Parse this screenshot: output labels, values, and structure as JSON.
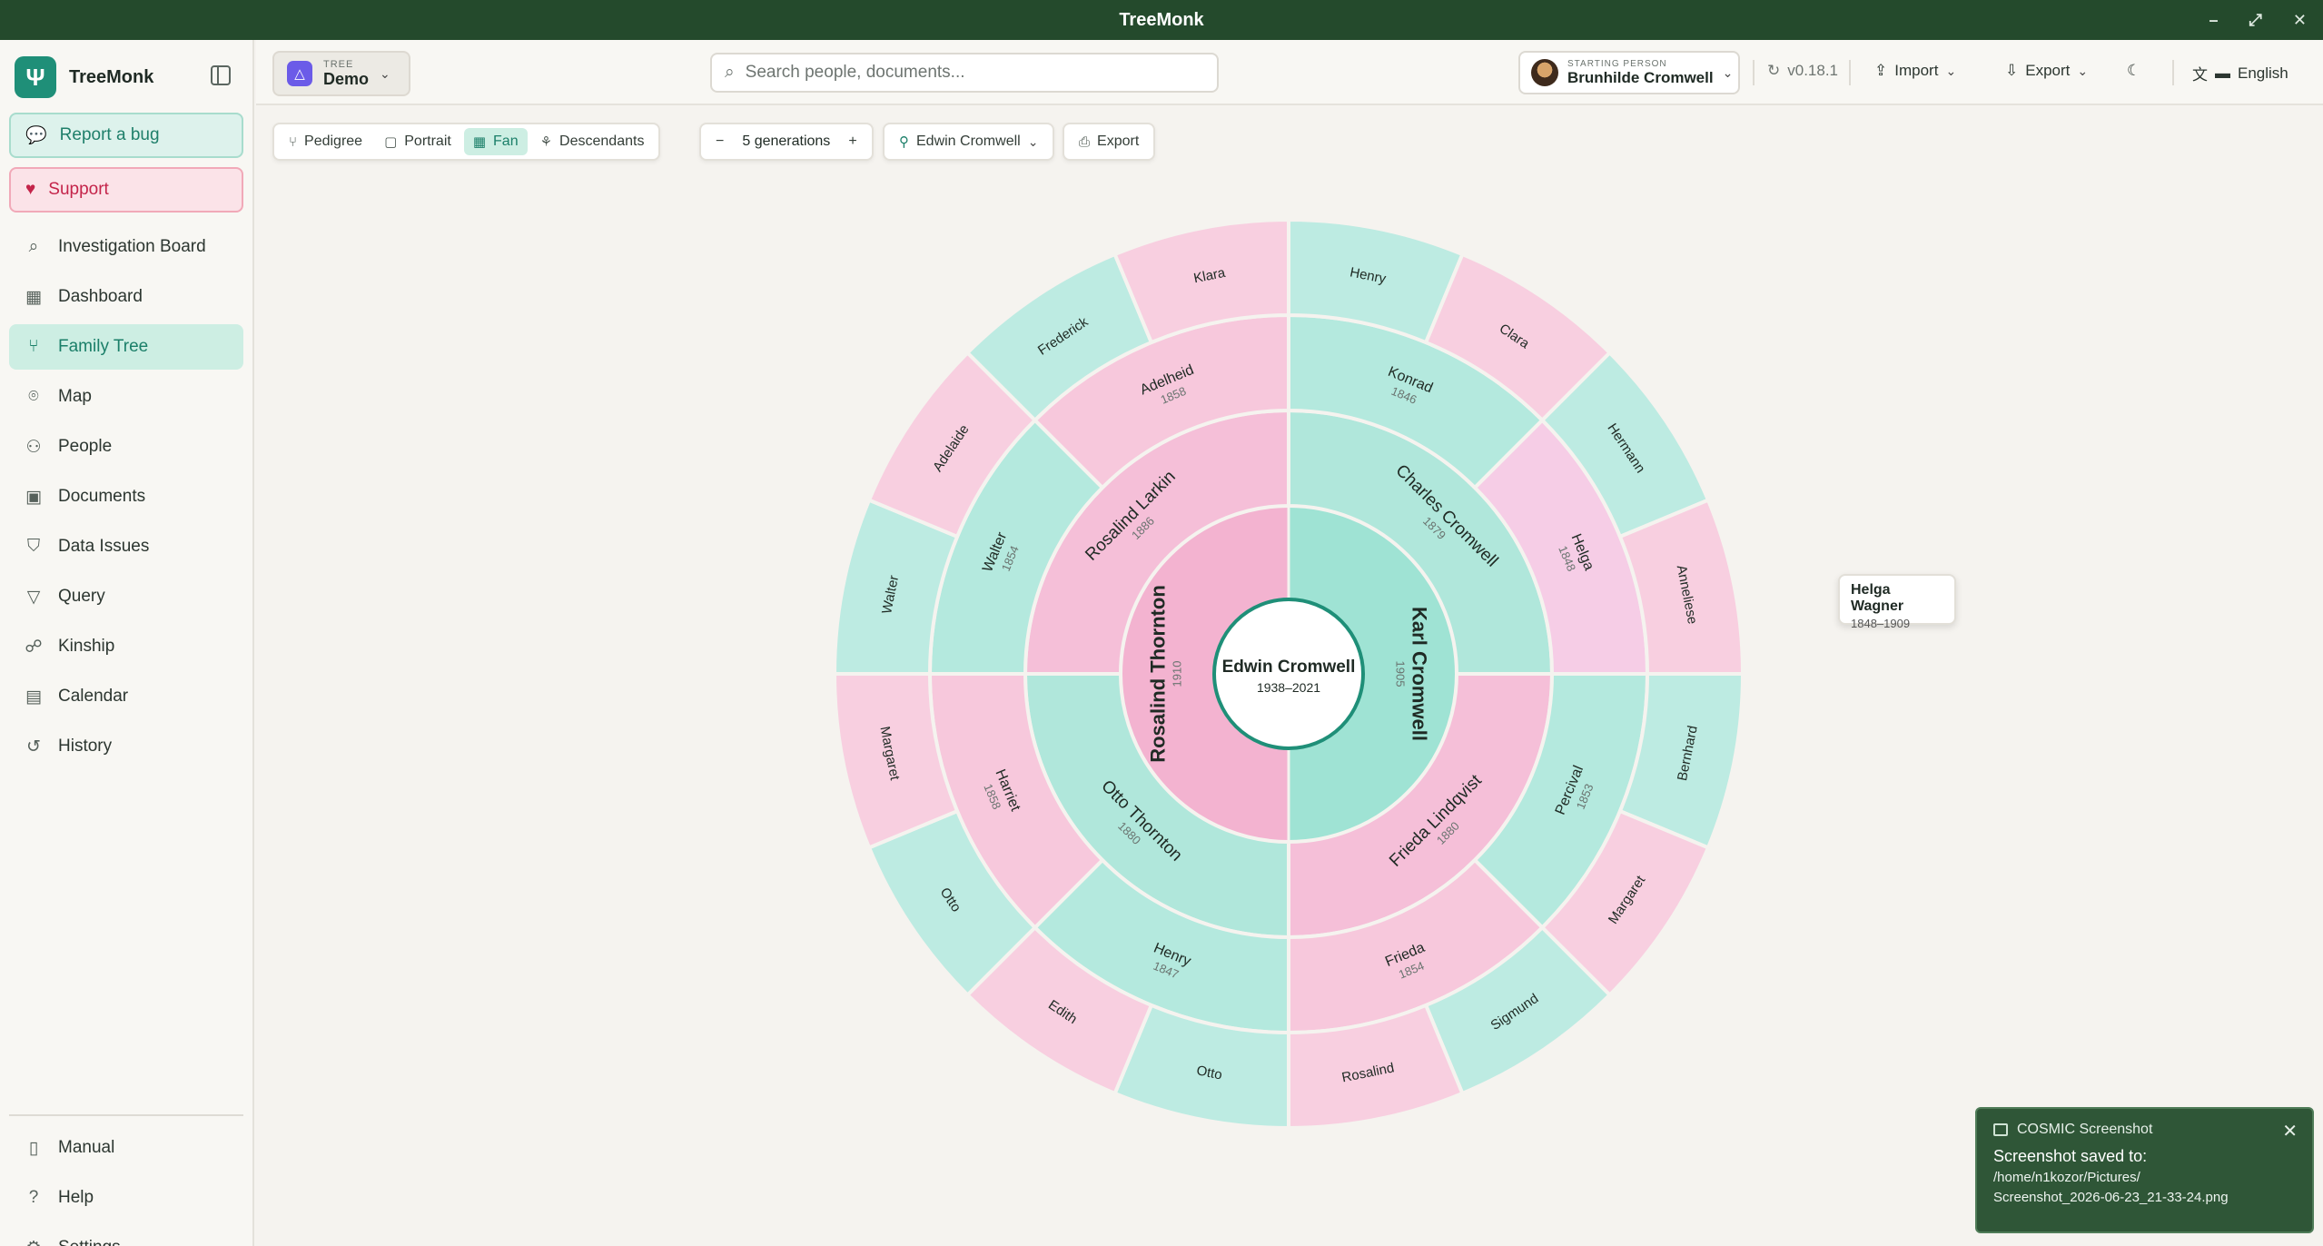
{
  "window": {
    "title": "TreeMonk"
  },
  "sidebar": {
    "brand": "TreeMonk",
    "report_bug": "Report a bug",
    "support": "Support",
    "items": [
      {
        "label": "Investigation Board",
        "icon": "search-icon"
      },
      {
        "label": "Dashboard",
        "icon": "dashboard-icon"
      },
      {
        "label": "Family Tree",
        "icon": "family-tree-icon",
        "active": true
      },
      {
        "label": "Map",
        "icon": "map-pin-icon"
      },
      {
        "label": "People",
        "icon": "people-icon"
      },
      {
        "label": "Documents",
        "icon": "documents-icon"
      },
      {
        "label": "Data Issues",
        "icon": "shield-icon"
      },
      {
        "label": "Query",
        "icon": "filter-icon"
      },
      {
        "label": "Kinship",
        "icon": "kinship-icon"
      },
      {
        "label": "Calendar",
        "icon": "calendar-icon"
      },
      {
        "label": "History",
        "icon": "history-icon"
      }
    ],
    "bottom": [
      {
        "label": "Manual",
        "icon": "book-icon"
      },
      {
        "label": "Help",
        "icon": "help-icon"
      },
      {
        "label": "Settings",
        "icon": "gear-icon"
      }
    ]
  },
  "header": {
    "tree_small": "TREE",
    "tree_name": "Demo",
    "search_placeholder": "Search people, documents...",
    "starting_small": "STARTING PERSON",
    "starting_name": "Brunhilde Cromwell",
    "version": "v0.18.1",
    "import": "Import",
    "export": "Export",
    "language": "English"
  },
  "toolbar": {
    "views": [
      "Pedigree",
      "Portrait",
      "Fan",
      "Descendants"
    ],
    "active_view": "Fan",
    "generations": "5 generations",
    "person": "Edwin Cromwell",
    "export": "Export"
  },
  "fan": {
    "root": {
      "name": "Edwin Cromwell",
      "years": "1938–2021"
    },
    "gen1": [
      {
        "name": "Karl Cromwell",
        "year": "1905",
        "sex": "M"
      },
      {
        "name": "Rosalind Thornton",
        "year": "1910",
        "sex": "F"
      }
    ],
    "gen2": [
      {
        "name": "Charles Cromwell",
        "year": "1879",
        "sex": "M"
      },
      {
        "name": "Frieda Lindqvist",
        "year": "1880",
        "sex": "F"
      },
      {
        "name": "Otto Thornton",
        "year": "1880",
        "sex": "M"
      },
      {
        "name": "Rosalind Larkin",
        "year": "1886",
        "sex": "F"
      }
    ],
    "gen3": [
      {
        "name": "Konrad",
        "year": "1846",
        "sex": "M"
      },
      {
        "name": "Helga",
        "year": "1848",
        "sex": "F",
        "highlight": true
      },
      {
        "name": "Percival",
        "year": "1853",
        "sex": "M"
      },
      {
        "name": "Frieda",
        "year": "1854",
        "sex": "F"
      },
      {
        "name": "Henry",
        "year": "1847",
        "sex": "M"
      },
      {
        "name": "Harriet",
        "year": "1858",
        "sex": "F"
      },
      {
        "name": "Walter",
        "year": "1854",
        "sex": "M"
      },
      {
        "name": "Adelheid",
        "year": "1858",
        "sex": "F"
      }
    ],
    "gen4": [
      {
        "name": "Henry",
        "sex": "M"
      },
      {
        "name": "Clara",
        "sex": "F"
      },
      {
        "name": "Hermann",
        "sex": "M"
      },
      {
        "name": "Anneliese",
        "sex": "F"
      },
      {
        "name": "Bernhard",
        "sex": "M"
      },
      {
        "name": "Margaret",
        "sex": "F"
      },
      {
        "name": "Sigmund",
        "sex": "M"
      },
      {
        "name": "Rosalind",
        "sex": "F"
      },
      {
        "name": "Otto",
        "sex": "M"
      },
      {
        "name": "Edith",
        "sex": "F"
      },
      {
        "name": "Otto",
        "sex": "M"
      },
      {
        "name": "Margaret",
        "sex": "F"
      },
      {
        "name": "Walter",
        "sex": "M"
      },
      {
        "name": "Adelaide",
        "sex": "F"
      },
      {
        "name": "Frederick",
        "sex": "M"
      },
      {
        "name": "Klara",
        "sex": "F"
      }
    ],
    "colors": {
      "male": [
        "#9fe3d4",
        "#b0e7db",
        "#b4e9de",
        "#bdebe2"
      ],
      "female": [
        "#f3b3d0",
        "#f5bfd8",
        "#f7c8dc",
        "#f8cfe0"
      ],
      "highlight": "#f6cde6"
    }
  },
  "tooltip": {
    "name": "Helga Wagner",
    "years": "1848–1909"
  },
  "notification": {
    "app": "COSMIC Screenshot",
    "title": "Screenshot saved to:",
    "line1": "/home/n1kozor/Pictures/",
    "line2": "Screenshot_2026-06-23_21-33-24.png"
  }
}
